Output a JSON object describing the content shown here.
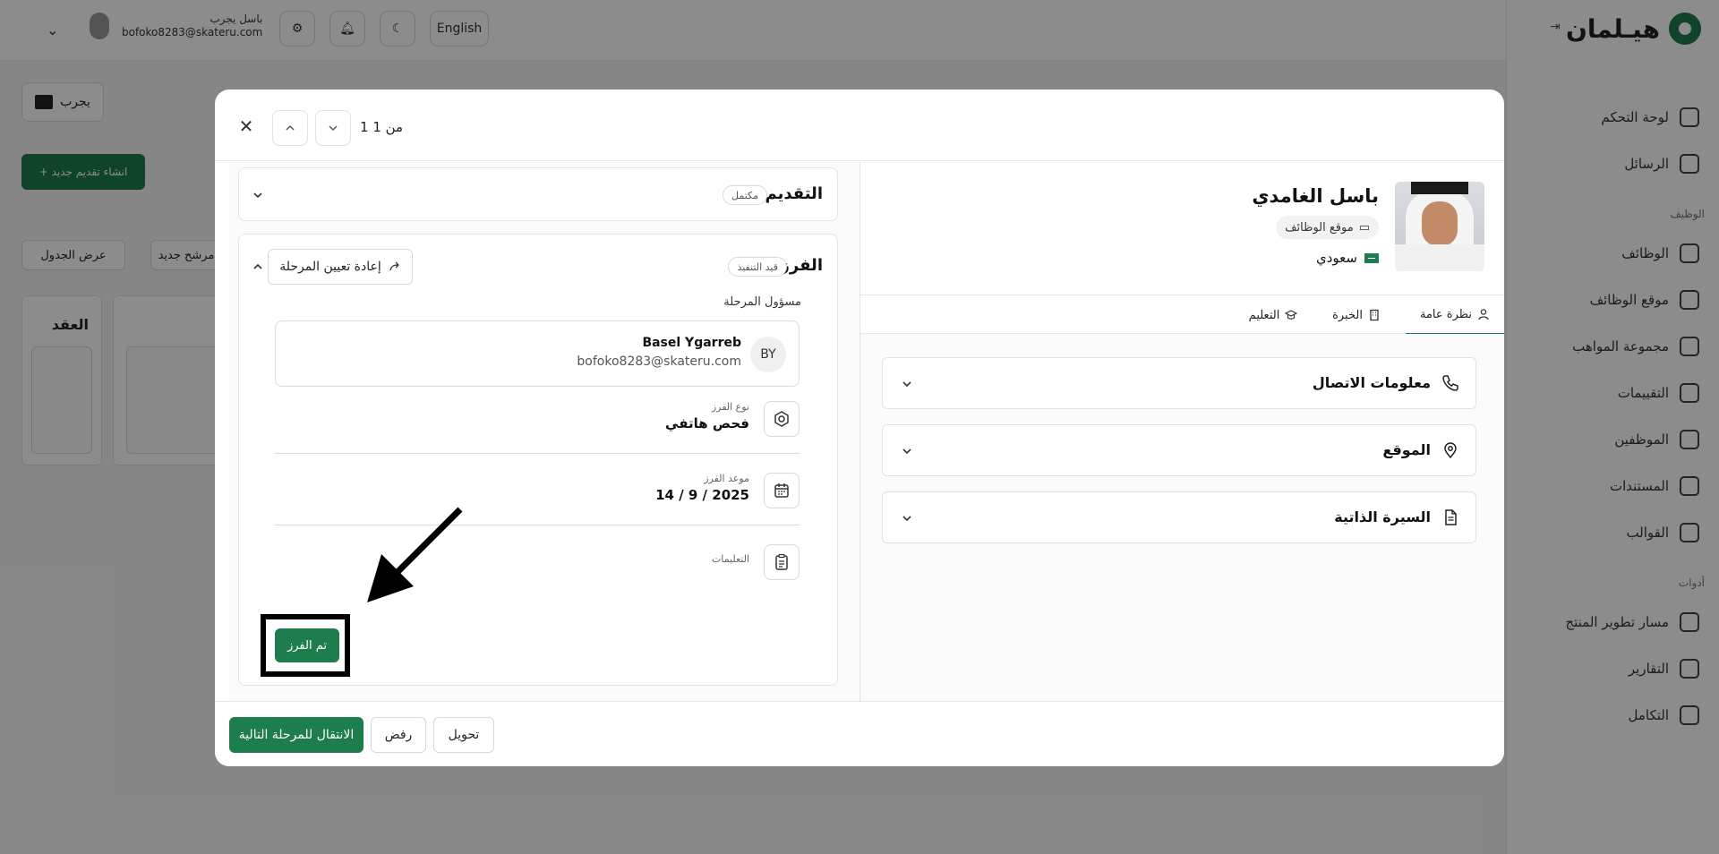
{
  "app": {
    "logo_text": "هيـلمان",
    "language_button": "English",
    "user": {
      "name": "باسل يجرب",
      "email": "bofoko8283@skateru.com"
    },
    "filter_button": "يجرب",
    "new_application_button": "+ انشاء تقديم جديد",
    "view_buttons": {
      "table_view": "عرض الجدول",
      "new_candidate": "مرشح جديد"
    },
    "kanban_column_title": "العقد",
    "sidebar": {
      "group_jobs": "الوظيف",
      "group_tools": "أدوات",
      "items": [
        {
          "label": "لوحة التحكم",
          "icon": "dashboard-icon"
        },
        {
          "label": "الرسائل",
          "icon": "mail-icon"
        },
        {
          "label": "الوظائف",
          "icon": "briefcase-icon"
        },
        {
          "label": "موقع الوظائف",
          "icon": "laptop-icon"
        },
        {
          "label": "مجموعة المواهب",
          "icon": "info-icon"
        },
        {
          "label": "التقييمات",
          "icon": "store-icon"
        },
        {
          "label": "الموظفين",
          "icon": "user-icon"
        },
        {
          "label": "المستندات",
          "icon": "document-icon"
        },
        {
          "label": "القوالب",
          "icon": "template-icon"
        },
        {
          "label": "مسار تطوير المنتج",
          "icon": "flame-icon"
        },
        {
          "label": "التقارير",
          "icon": "report-icon"
        },
        {
          "label": "التكامل",
          "icon": "link-icon"
        }
      ]
    }
  },
  "modal": {
    "counter": "1 من 1",
    "left": {
      "application_stage": {
        "title": "التقديم",
        "status": "مكتمل"
      },
      "screening_stage": {
        "title": "الفرز",
        "status": "قيد التنفيذ",
        "reassign_button": "إعادة تعيين المرحلة",
        "owner_label": "مسؤول المرحلة",
        "owner": {
          "initials": "BY",
          "name": "Basel Ygarreb",
          "email": "bofoko8283@skateru.com"
        },
        "screening_type_label": "نوع الفرز",
        "screening_type_value": "فحص هاتفي",
        "screening_date_label": "موعد الفرز",
        "screening_date_value": "14 / 9 / 2025",
        "instructions_label": "التعليمات",
        "done_button": "تم الفرز"
      }
    },
    "right": {
      "candidate_name": "باسل الغامدي",
      "source": "موقع الوظائف",
      "nationality": "سعودي",
      "tabs": [
        "نظرة عامة",
        "الخبرة",
        "التعليم"
      ],
      "sections": [
        "معلومات الاتصال",
        "الموقع",
        "السيرة الذاتية"
      ]
    },
    "footer": {
      "next_stage_button": "الانتقال للمرحلة التالية",
      "reject_button": "رفض",
      "transfer_button": "تحويل"
    }
  },
  "colors": {
    "accent": "#1e7d4d",
    "overlay": "rgba(0,0,0,0.45)"
  }
}
